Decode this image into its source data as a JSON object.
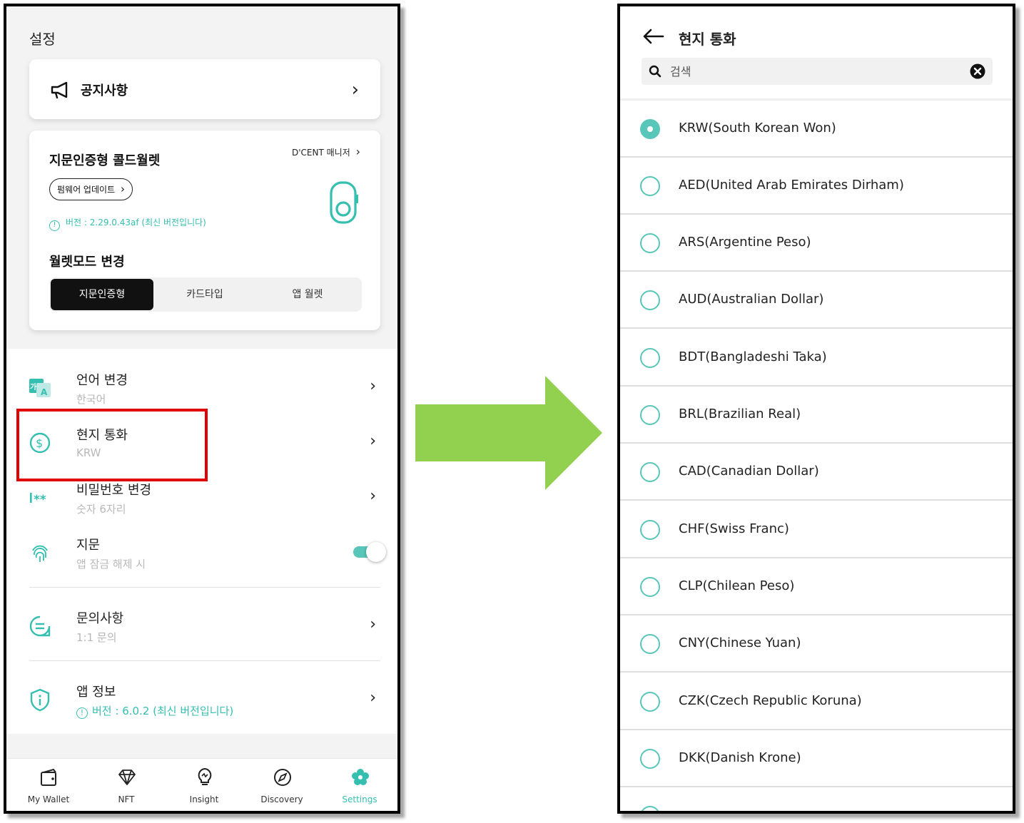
{
  "left": {
    "title": "설정",
    "notice_label": "공지사항",
    "wallet_card": {
      "title": "지문인증형 콜드월렛",
      "manager_link": "D'CENT 매니저",
      "firmware_button": "펌웨어 업데이트",
      "version_text": "버전 : 2.29.0.43af (최신 버전입니다)",
      "mode_title": "월렛모드 변경",
      "modes": [
        "지문인증형",
        "카드타입",
        "앱 월렛"
      ],
      "selected_mode": "지문인증형"
    },
    "settings_rows": [
      {
        "title": "언어 변경",
        "subtitle": "한국어"
      },
      {
        "title": "현지 통화",
        "subtitle": "KRW"
      },
      {
        "title": "비밀번호 변경",
        "subtitle": "숫자 6자리"
      },
      {
        "title": "지문",
        "subtitle": "앱 잠금 해제 시",
        "toggle": "on"
      },
      {
        "title": "문의사항",
        "subtitle": "1:1 문의"
      },
      {
        "title": "앱 정보",
        "subtitle": "버전 : 6.0.2 (최신 버전입니다)"
      }
    ],
    "bottom_nav": [
      {
        "label": "My Wallet",
        "icon": "wallet-icon"
      },
      {
        "label": "NFT",
        "icon": "diamond-icon"
      },
      {
        "label": "Insight",
        "icon": "lightbulb-icon"
      },
      {
        "label": "Discovery",
        "icon": "compass-icon"
      },
      {
        "label": "Settings",
        "icon": "gear-icon",
        "active": true
      }
    ]
  },
  "right": {
    "title": "현지 통화",
    "search_placeholder": "검색",
    "currencies": [
      "KRW(South Korean Won)",
      "AED(United Arab Emirates Dirham)",
      "ARS(Argentine Peso)",
      "AUD(Australian Dollar)",
      "BDT(Bangladeshi Taka)",
      "BRL(Brazilian Real)",
      "CAD(Canadian Dollar)",
      "CHF(Swiss Franc)",
      "CLP(Chilean Peso)",
      "CNY(Chinese Yuan)",
      "CZK(Czech Republic Koruna)",
      "DKK(Danish Krone)"
    ],
    "selected_currency": "KRW(South Korean Won)"
  },
  "colors": {
    "accent": "#59c6ba",
    "highlight": "#e00000",
    "arrow": "#92d050"
  }
}
